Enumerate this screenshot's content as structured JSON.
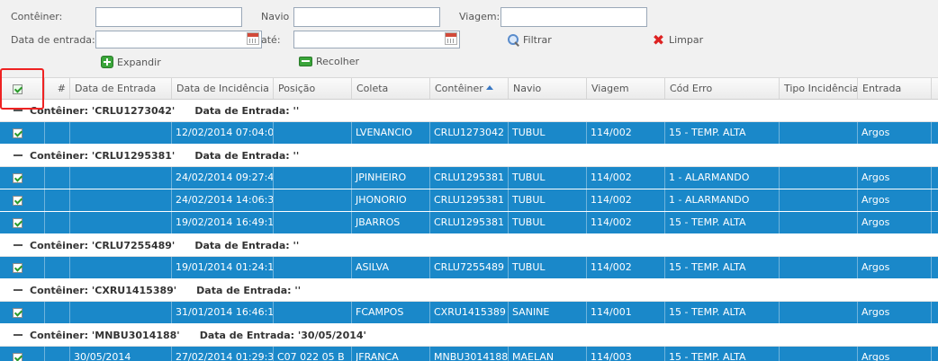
{
  "filters": {
    "container_label": "Contêiner:",
    "container_value": "",
    "vessel_label": "Navio",
    "vessel_value": "",
    "voyage_label": "Viagem:",
    "voyage_value": "",
    "entry_date_label": "Data de entrada:",
    "entry_date_value": "",
    "until_label": "até:",
    "until_value": "",
    "filter_button": "Filtrar",
    "clear_button": "Limpar",
    "expand_button": "Expandir",
    "collapse_button": "Recolher"
  },
  "columns": [
    "#",
    "Data de Entrada",
    "Data de Incidência",
    "Posição",
    "Coleta",
    "Contêiner",
    "Navio",
    "Viagem",
    "Cód Erro",
    "Tipo Incidência",
    "Entrada"
  ],
  "groups": [
    {
      "container_caption": "Contêiner: 'CRLU1273042'",
      "date_caption": "Data de Entrada: ''",
      "rows": [
        {
          "num": "",
          "entry_date": "",
          "incident_date": "12/02/2014 07:04:0",
          "position": "",
          "collector": "LVENANCIO",
          "container": "CRLU1273042",
          "vessel": "TUBUL",
          "voyage": "114/002",
          "error_code": "15 - TEMP. ALTA",
          "incident_type": "",
          "entrance": "Argos"
        }
      ]
    },
    {
      "container_caption": "Contêiner: 'CRLU1295381'",
      "date_caption": "Data de Entrada: ''",
      "rows": [
        {
          "num": "",
          "entry_date": "",
          "incident_date": "24/02/2014 09:27:4",
          "position": "",
          "collector": "JPINHEIRO",
          "container": "CRLU1295381",
          "vessel": "TUBUL",
          "voyage": "114/002",
          "error_code": "1 - ALARMANDO",
          "incident_type": "",
          "entrance": "Argos"
        },
        {
          "num": "",
          "entry_date": "",
          "incident_date": "24/02/2014 14:06:3",
          "position": "",
          "collector": "JHONORIO",
          "container": "CRLU1295381",
          "vessel": "TUBUL",
          "voyage": "114/002",
          "error_code": "1 - ALARMANDO",
          "incident_type": "",
          "entrance": "Argos"
        },
        {
          "num": "",
          "entry_date": "",
          "incident_date": "19/02/2014 16:49:1",
          "position": "",
          "collector": "JBARROS",
          "container": "CRLU1295381",
          "vessel": "TUBUL",
          "voyage": "114/002",
          "error_code": "15 - TEMP. ALTA",
          "incident_type": "",
          "entrance": "Argos"
        }
      ]
    },
    {
      "container_caption": "Contêiner: 'CRLU7255489'",
      "date_caption": "Data de Entrada: ''",
      "rows": [
        {
          "num": "",
          "entry_date": "",
          "incident_date": "19/01/2014 01:24:1",
          "position": "",
          "collector": "ASILVA",
          "container": "CRLU7255489",
          "vessel": "TUBUL",
          "voyage": "114/002",
          "error_code": "15 - TEMP. ALTA",
          "incident_type": "",
          "entrance": "Argos"
        }
      ]
    },
    {
      "container_caption": "Contêiner: 'CXRU1415389'",
      "date_caption": "Data de Entrada: ''",
      "rows": [
        {
          "num": "",
          "entry_date": "",
          "incident_date": "31/01/2014 16:46:1",
          "position": "",
          "collector": "FCAMPOS",
          "container": "CXRU1415389",
          "vessel": "SANINE",
          "voyage": "114/001",
          "error_code": "15 - TEMP. ALTA",
          "incident_type": "",
          "entrance": "Argos"
        }
      ]
    },
    {
      "container_caption": "Contêiner: 'MNBU3014188'",
      "date_caption": "Data de Entrada: '30/05/2014'",
      "rows": [
        {
          "num": "",
          "entry_date": "30/05/2014",
          "incident_date": "27/02/2014 01:29:3",
          "position": "C07 022 05 B",
          "collector": "JFRANCA",
          "container": "MNBU3014188",
          "vessel": "MAELAN",
          "voyage": "114/003",
          "error_code": "15 - TEMP. ALTA",
          "incident_type": "",
          "entrance": "Argos"
        }
      ]
    }
  ]
}
